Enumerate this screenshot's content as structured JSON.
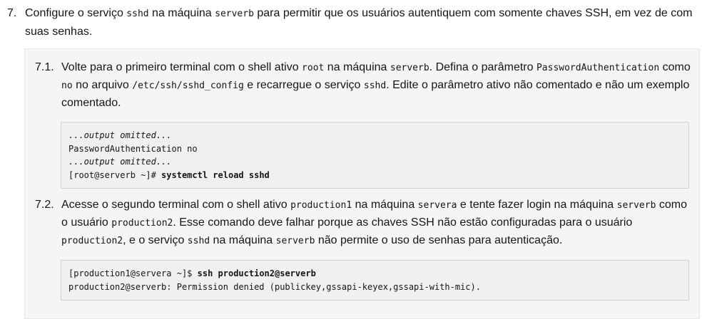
{
  "step7": {
    "number": "7.",
    "t1": "Configure o serviço ",
    "c1": "sshd",
    "t2": " na máquina ",
    "c2": "serverb",
    "t3": " para permitir que os usuários autentiquem com somente chaves SSH, em vez de com suas senhas."
  },
  "step71": {
    "number": "7.1.",
    "t1": "Volte para o primeiro terminal com o shell ativo ",
    "c1": "root",
    "t2": " na máquina ",
    "c2": "serverb",
    "t3": ". Defina o parâmetro ",
    "c3": "PasswordAuthentication",
    "t4": " como ",
    "c4": "no",
    "t5": " no arquivo ",
    "c5": "/etc/ssh/sshd_config",
    "t6": " e recarregue o serviço ",
    "c6": "sshd",
    "t7": ". Edite o parâmetro ativo não comentado e não um exemplo comentado.",
    "code": {
      "line1": "...output omitted...",
      "line2": "PasswordAuthentication no",
      "line3": "...output omitted...",
      "line4_prompt": "[root@serverb ~]# ",
      "line4_cmd": "systemctl reload sshd"
    }
  },
  "step72": {
    "number": "7.2.",
    "t1": "Acesse o segundo terminal com o shell ativo ",
    "c1": "production1",
    "t2": " na máquina ",
    "c2": "servera",
    "t3": " e tente fazer login na máquina ",
    "c3": "serverb",
    "t4": " como o usuário ",
    "c4": "production2",
    "t5": ". Esse comando deve falhar porque as chaves SSH não estão configuradas para o usuário ",
    "c5": "production2",
    "t6": ", e o serviço ",
    "c6": "sshd",
    "t7": " na máquina ",
    "c7": "serverb",
    "t8": " não permite o uso de senhas para autenticação.",
    "code": {
      "line1_prompt": "[production1@servera ~]$ ",
      "line1_cmd": "ssh production2@serverb",
      "line2": "production2@serverb: Permission denied (publickey,gssapi-keyex,gssapi-with-mic)."
    }
  }
}
